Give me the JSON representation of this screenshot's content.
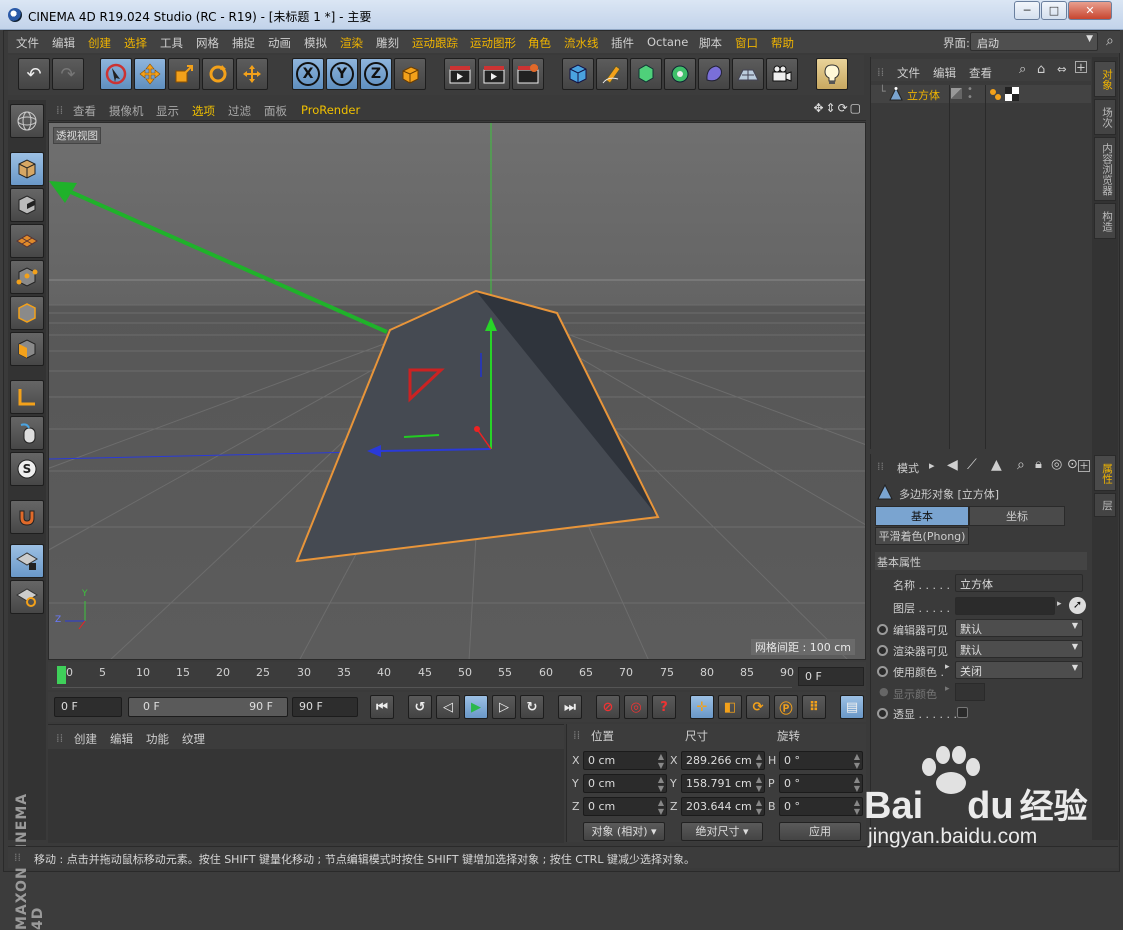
{
  "window": {
    "title": "CINEMA 4D R19.024 Studio (RC - R19) - [未标题 1 *] - 主要",
    "minimize": "─",
    "maximize": "□",
    "close": "✕"
  },
  "menubar": {
    "items": [
      {
        "label": "文件",
        "accent": false
      },
      {
        "label": "编辑",
        "accent": false
      },
      {
        "label": "创建",
        "accent": true
      },
      {
        "label": "选择",
        "accent": true
      },
      {
        "label": "工具",
        "accent": false
      },
      {
        "label": "网格",
        "accent": false
      },
      {
        "label": "捕捉",
        "accent": false
      },
      {
        "label": "动画",
        "accent": false
      },
      {
        "label": "模拟",
        "accent": false
      },
      {
        "label": "渲染",
        "accent": true
      },
      {
        "label": "雕刻",
        "accent": false
      },
      {
        "label": "运动跟踪",
        "accent": true
      },
      {
        "label": "运动图形",
        "accent": true
      },
      {
        "label": "角色",
        "accent": true
      },
      {
        "label": "流水线",
        "accent": true
      },
      {
        "label": "插件",
        "accent": false
      },
      {
        "label": "Octane",
        "accent": false
      },
      {
        "label": "脚本",
        "accent": false
      },
      {
        "label": "窗口",
        "accent": true
      },
      {
        "label": "帮助",
        "accent": true
      }
    ],
    "interface_label": "界面:",
    "interface_value": "启动"
  },
  "toolbar": {
    "undo": "↶",
    "redo": "↷",
    "axis_x": "X",
    "axis_y": "Y",
    "axis_z": "Z"
  },
  "viewport": {
    "menus": [
      {
        "label": "查看",
        "accent": false
      },
      {
        "label": "摄像机",
        "accent": false
      },
      {
        "label": "显示",
        "accent": false
      },
      {
        "label": "选项",
        "accent": true
      },
      {
        "label": "过滤",
        "accent": false
      },
      {
        "label": "面板",
        "accent": false
      },
      {
        "label": "ProRender",
        "accent": true
      }
    ],
    "view_name": "透视视图",
    "grid_spacing": "网格间距 : 100 cm",
    "axis_y": "Y",
    "axis_z": "Z"
  },
  "timeline": {
    "ticks": [
      "0",
      "5",
      "10",
      "15",
      "20",
      "25",
      "30",
      "35",
      "40",
      "45",
      "50",
      "55",
      "60",
      "65",
      "70",
      "75",
      "80",
      "85",
      "90"
    ],
    "current_frame": "0 F"
  },
  "playback": {
    "start_field": "0 F",
    "range_start": "0 F",
    "range_end": "90 F",
    "end_field": "90 F"
  },
  "material_panel": {
    "menus": [
      "创建",
      "编辑",
      "功能",
      "纹理"
    ]
  },
  "coord_panel": {
    "headers": {
      "position": "位置",
      "size": "尺寸",
      "rotation": "旋转"
    },
    "rows": [
      {
        "pos_label": "X",
        "pos": "0 cm",
        "size_label": "X",
        "size": "289.266 cm",
        "rot_label": "H",
        "rot": "0 °"
      },
      {
        "pos_label": "Y",
        "pos": "0 cm",
        "size_label": "Y",
        "size": "158.791 cm",
        "rot_label": "P",
        "rot": "0 °"
      },
      {
        "pos_label": "Z",
        "pos": "0 cm",
        "size_label": "Z",
        "size": "203.644 cm",
        "rot_label": "B",
        "rot": "0 °"
      }
    ],
    "mode_select": "对象 (相对)",
    "size_select": "绝对尺寸",
    "apply": "应用"
  },
  "object_manager": {
    "menus": [
      "文件",
      "编辑",
      "查看"
    ],
    "object_name": "立方体"
  },
  "attribute_manager": {
    "mode_label": "模式",
    "object_title": "多边形对象 [立方体]",
    "tabs": {
      "basic": "基本",
      "coord": "坐标"
    },
    "phong_tab": "平滑着色(Phong)",
    "section_title": "基本属性",
    "fields": {
      "name_label": "名称 . . . . .",
      "name_value": "立方体",
      "layer_label": "图层 . . . . .",
      "editor_vis_label": "编辑器可见",
      "editor_vis_value": "默认",
      "render_vis_label": "渲染器可见",
      "render_vis_value": "默认",
      "use_color_label": "使用颜色 .",
      "use_color_value": "关闭",
      "display_color_label": "显示颜色",
      "xray_label": "透显 . . . . . ."
    }
  },
  "right_tabs": [
    {
      "label": "对象",
      "accent": true
    },
    {
      "label": "场次",
      "accent": false
    },
    {
      "label": "内容浏览器",
      "accent": false
    },
    {
      "label": "构造",
      "accent": false
    },
    {
      "label": "属性",
      "accent": true
    },
    {
      "label": "层",
      "accent": false
    }
  ],
  "status": "移动 : 点击并拖动鼠标移动元素。按住 SHIFT 键量化移动 ; 节点编辑模式时按住 SHIFT 键增加选择对象 ; 按住 CTRL 键减少选择对象。",
  "brand": {
    "maxon": "MAXON",
    "product": "CINEMA 4D"
  },
  "watermark": {
    "brand": "Bai",
    "brand2": "du",
    "product": "经验",
    "url": "jingyan.baidu.com"
  },
  "colors": {
    "accent": "#f0b400",
    "object_outline": "#e8953a",
    "selection_blue": "#7aa4d0"
  }
}
